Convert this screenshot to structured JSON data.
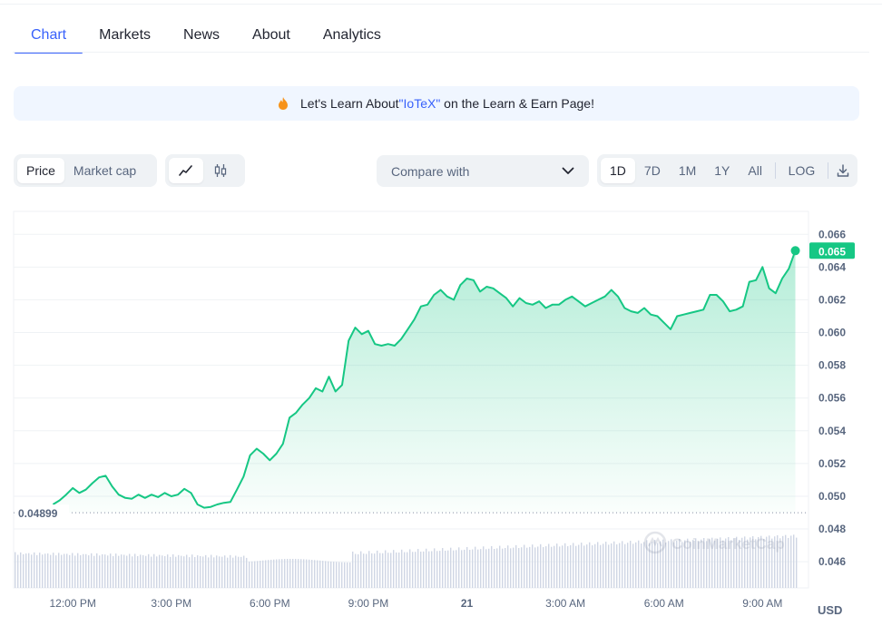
{
  "tabs": [
    "Chart",
    "Markets",
    "News",
    "About",
    "Analytics"
  ],
  "banner": {
    "pre": "Let's Learn About ",
    "highlight": "\"IoTeX\"",
    "post": " on the Learn & Earn Page!"
  },
  "controls": {
    "type_options": [
      "Price",
      "Market cap"
    ],
    "selected_type": "Price",
    "view_icons": [
      "line-chart-icon",
      "candlestick-icon"
    ],
    "compare_label": "Compare with",
    "ranges": [
      "1D",
      "7D",
      "1M",
      "1Y",
      "All"
    ],
    "selected_range": "1D",
    "log_label": "LOG",
    "download_icon": "download-icon"
  },
  "currency": "USD",
  "watermark": "CoinMarketCap",
  "colors": {
    "line": "#16c784",
    "accent": "#3861fb",
    "volume": "#cfd6e4"
  },
  "chart_data": {
    "type": "area",
    "y_ticks": [
      0.046,
      0.048,
      0.05,
      0.052,
      0.054,
      0.056,
      0.058,
      0.06,
      0.062,
      0.064,
      0.066
    ],
    "y_tick_labels": [
      "0.046",
      "0.048",
      "0.050",
      "0.052",
      "0.054",
      "0.056",
      "0.058",
      "0.060",
      "0.062",
      "0.064",
      "0.066"
    ],
    "ylim": [
      0.0444,
      0.0674
    ],
    "x_ticks": [
      12,
      15,
      18,
      21,
      24,
      27,
      30,
      33
    ],
    "x_tick_labels": [
      "12:00 PM",
      "3:00 PM",
      "6:00 PM",
      "9:00 PM",
      "21",
      "3:00 AM",
      "6:00 AM",
      "9:00 AM"
    ],
    "xlim": [
      10.2,
      34.4
    ],
    "reference_value": 0.04899,
    "reference_label": "0.04899",
    "last_price": 0.065,
    "last_price_label": "0.065",
    "hours": [
      11.4,
      11.6,
      11.8,
      12.0,
      12.2,
      12.4,
      12.6,
      12.8,
      13.0,
      13.2,
      13.4,
      13.6,
      13.8,
      14.0,
      14.2,
      14.4,
      14.6,
      14.8,
      15.0,
      15.2,
      15.4,
      15.6,
      15.8,
      16.0,
      16.2,
      16.4,
      16.6,
      16.8,
      17.0,
      17.2,
      17.4,
      17.6,
      17.8,
      18.0,
      18.2,
      18.4,
      18.6,
      18.8,
      19.0,
      19.2,
      19.4,
      19.6,
      19.8,
      20.0,
      20.2,
      20.4,
      20.6,
      20.8,
      21.0,
      21.2,
      21.4,
      21.6,
      21.8,
      22.0,
      22.2,
      22.4,
      22.6,
      22.8,
      23.0,
      23.2,
      23.4,
      23.6,
      23.8,
      24.0,
      24.2,
      24.4,
      24.6,
      24.8,
      25.0,
      25.2,
      25.4,
      25.6,
      25.8,
      26.0,
      26.2,
      26.4,
      26.6,
      26.8,
      27.0,
      27.2,
      27.4,
      27.6,
      27.8,
      28.0,
      28.2,
      28.4,
      28.6,
      28.8,
      29.0,
      29.2,
      29.4,
      29.6,
      29.8,
      30.0,
      30.2,
      30.4,
      30.6,
      30.8,
      31.0,
      31.2,
      31.4,
      31.6,
      31.8,
      32.0,
      32.2,
      32.4,
      32.6,
      32.8,
      33.0,
      33.2,
      33.4,
      33.6,
      33.8,
      34.0
    ],
    "prices": [
      0.0495,
      0.04975,
      0.0501,
      0.0505,
      0.0502,
      0.0504,
      0.0508,
      0.05115,
      0.05125,
      0.0506,
      0.0501,
      0.0499,
      0.04985,
      0.0501,
      0.0499,
      0.0501,
      0.04995,
      0.0502,
      0.05,
      0.0501,
      0.05045,
      0.0502,
      0.0495,
      0.0493,
      0.04935,
      0.0495,
      0.0496,
      0.04965,
      0.0504,
      0.0512,
      0.0525,
      0.0529,
      0.0526,
      0.0522,
      0.0526,
      0.0532,
      0.0548,
      0.0551,
      0.0556,
      0.056,
      0.0566,
      0.0564,
      0.0573,
      0.0564,
      0.0568,
      0.0595,
      0.0603,
      0.0599,
      0.0601,
      0.0593,
      0.0592,
      0.0593,
      0.0592,
      0.0596,
      0.0602,
      0.0608,
      0.0616,
      0.0617,
      0.0623,
      0.0626,
      0.0622,
      0.062,
      0.0629,
      0.0633,
      0.0632,
      0.0625,
      0.0628,
      0.0627,
      0.0624,
      0.0621,
      0.0616,
      0.0621,
      0.0618,
      0.0617,
      0.0619,
      0.0615,
      0.0617,
      0.0617,
      0.062,
      0.0622,
      0.0619,
      0.0616,
      0.0618,
      0.062,
      0.0622,
      0.0626,
      0.0622,
      0.0615,
      0.0613,
      0.0612,
      0.0615,
      0.0611,
      0.061,
      0.0606,
      0.0602,
      0.061,
      0.0611,
      0.0612,
      0.0613,
      0.0614,
      0.0623,
      0.0623,
      0.0619,
      0.0613,
      0.0614,
      0.0616,
      0.0631,
      0.0632,
      0.064,
      0.0627,
      0.0624,
      0.0633,
      0.0639,
      0.065
    ],
    "volume_note": "relative volume bars along bottom, no axis labels"
  }
}
